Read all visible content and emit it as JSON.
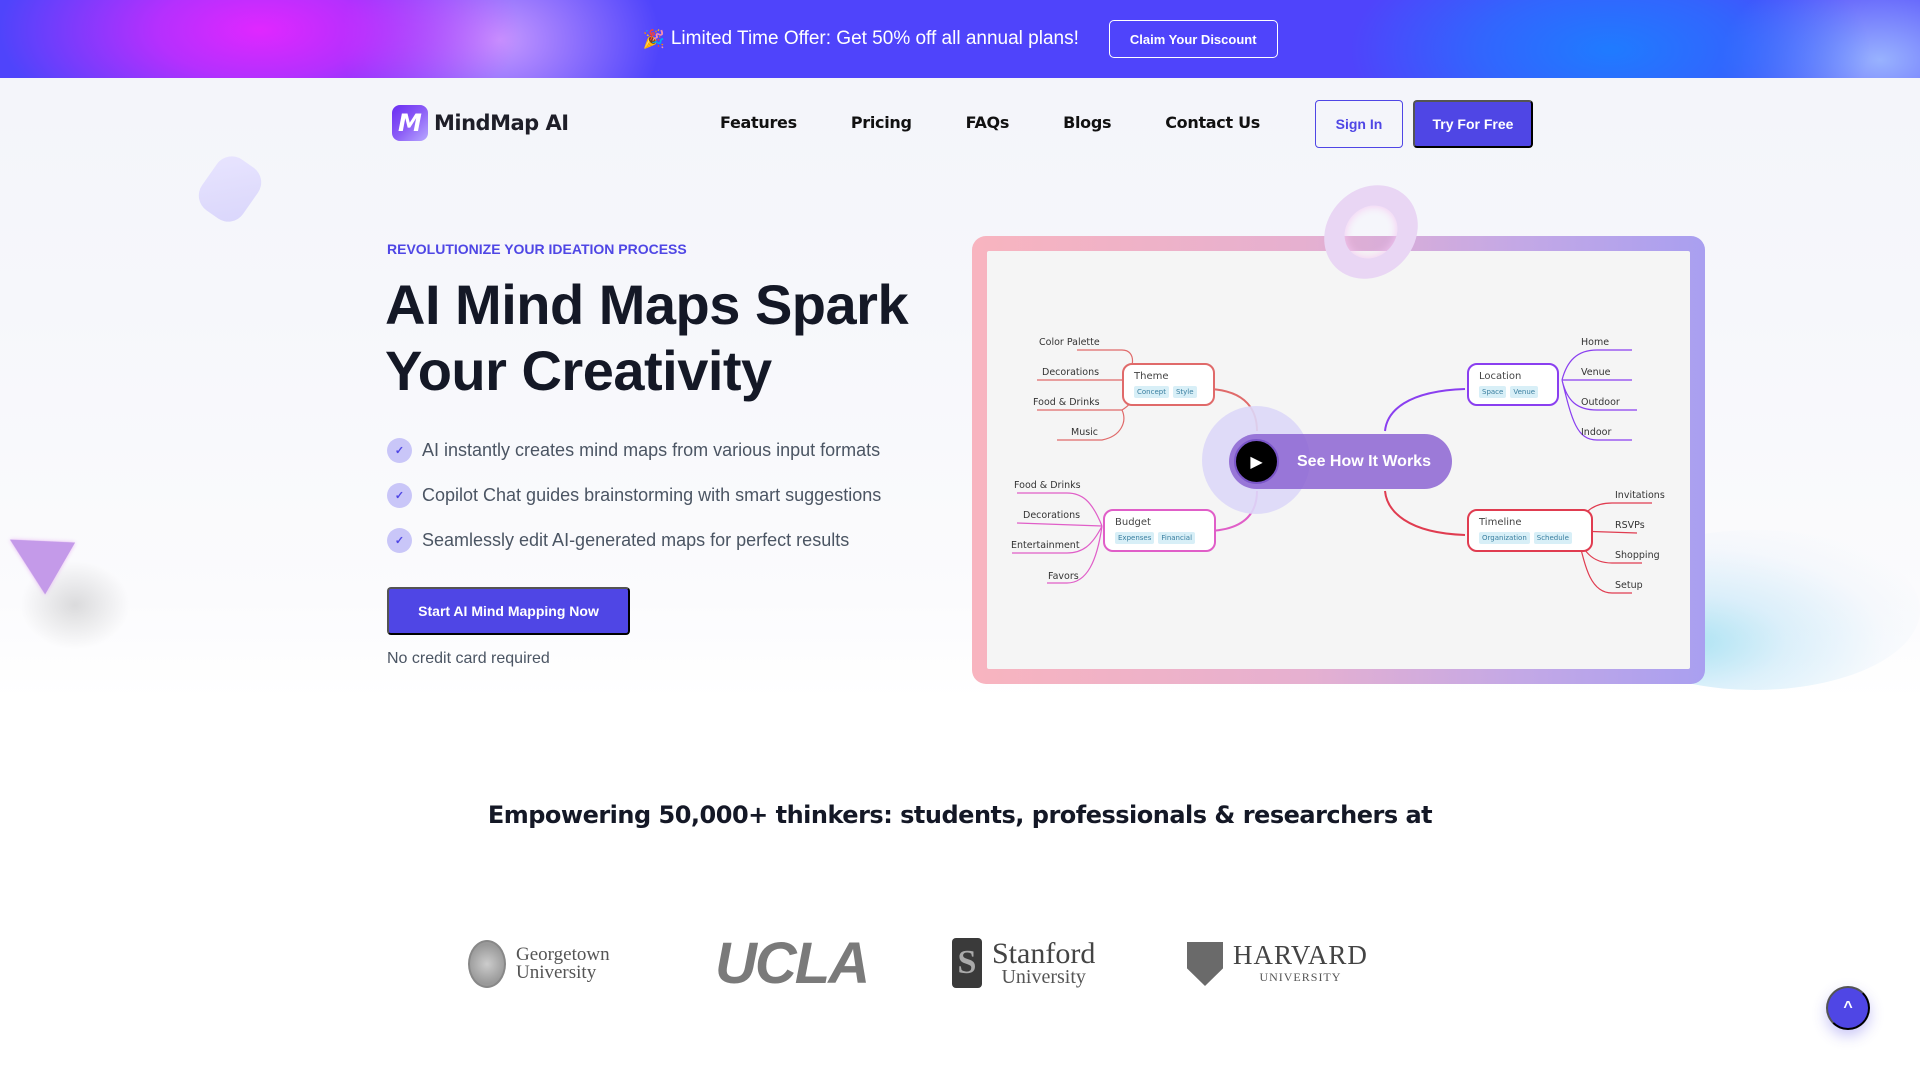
{
  "promo": {
    "icon": "party-popper-icon",
    "icon_glyph": "🎉",
    "text": "Limited Time Offer: Get 50% off all annual plans!",
    "button_label": "Claim Your Discount"
  },
  "header": {
    "logo_glyph": "M",
    "logo_text": "MindMap AI",
    "nav": [
      "Features",
      "Pricing",
      "FAQs",
      "Blogs",
      "Contact Us"
    ],
    "sign_in_label": "Sign In",
    "try_free_label": "Try For Free"
  },
  "hero": {
    "eyebrow": "REVOLUTIONIZE YOUR IDEATION PROCESS",
    "headline": "AI Mind Maps Spark Your Creativity",
    "features": [
      "AI instantly creates mind maps from various input formats",
      "Copilot Chat guides brainstorming with smart suggestions",
      "Seamlessly edit AI-generated maps for perfect results"
    ],
    "check_glyph": "✓",
    "cta_label": "Start AI Mind Mapping Now",
    "cta_note": "No credit card required"
  },
  "mindmap": {
    "video_label": "See How It Works",
    "play_glyph": "▶",
    "branches": [
      {
        "title": "Theme",
        "tags": [
          "Concept",
          "Style"
        ],
        "color": "#e06a6a",
        "leaves": [
          "Color Palette",
          "Decorations",
          "Food & Drinks",
          "Music"
        ]
      },
      {
        "title": "Location",
        "tags": [
          "Space",
          "Venue"
        ],
        "color": "#8a3ff0",
        "leaves": [
          "Home",
          "Venue",
          "Outdoor",
          "Indoor"
        ]
      },
      {
        "title": "Budget",
        "tags": [
          "Expenses",
          "Financial"
        ],
        "color": "#e05ec8",
        "leaves": [
          "Food & Drinks",
          "Decorations",
          "Entertainment",
          "Favors"
        ]
      },
      {
        "title": "Timeline",
        "tags": [
          "Organization",
          "Schedule"
        ],
        "color": "#e03c50",
        "leaves": [
          "Invitations",
          "RSVPs",
          "Shopping",
          "Setup"
        ]
      }
    ]
  },
  "social_proof": {
    "heading": "Empowering 50,000+ thinkers: students, professionals & researchers at",
    "logos": [
      {
        "name": "Georgetown",
        "line1": "Georgetown",
        "line2": "University"
      },
      {
        "name": "UCLA",
        "line1": "UCLA"
      },
      {
        "name": "Stanford",
        "line1": "Stanford",
        "line2": "University"
      },
      {
        "name": "Harvard",
        "line1": "HARVARD",
        "line2": "UNIVERSITY"
      }
    ]
  },
  "scroll_top_glyph": "^",
  "colors": {
    "primary": "#4f46e5",
    "heading": "#141826",
    "body_text": "#4b5563"
  }
}
